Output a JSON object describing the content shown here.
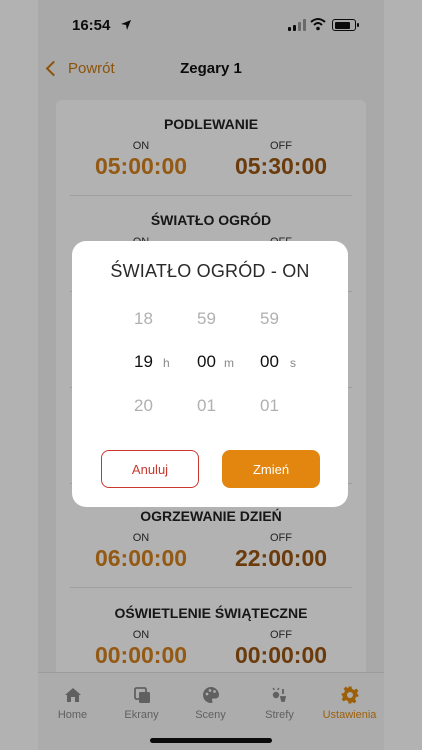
{
  "status_bar": {
    "time": "16:54"
  },
  "nav": {
    "back_label": "Powrót",
    "title": "Zegary 1"
  },
  "timers": [
    {
      "name": "PODLEWANIE",
      "on_label": "ON",
      "off_label": "OFF",
      "on": "05:00:00",
      "off": "05:30:00"
    },
    {
      "name": "ŚWIATŁO OGRÓD",
      "on_label": "ON",
      "off_label": "OFF",
      "on": "",
      "off": ""
    },
    {
      "name": "",
      "on_label": "",
      "off_label": "",
      "on": "",
      "off": ""
    },
    {
      "name": "",
      "on_label": "",
      "off_label": "",
      "on": "",
      "off": ""
    },
    {
      "name": "OGRZEWANIE DZIEŃ",
      "on_label": "ON",
      "off_label": "OFF",
      "on": "06:00:00",
      "off": "22:00:00"
    },
    {
      "name": "OŚWIETLENIE ŚWIĄTECZNE",
      "on_label": "ON",
      "off_label": "OFF",
      "on": "00:00:00",
      "off": "00:00:00"
    }
  ],
  "tabs": [
    {
      "label": "Home",
      "icon": "home-icon"
    },
    {
      "label": "Ekrany",
      "icon": "screens-icon"
    },
    {
      "label": "Sceny",
      "icon": "palette-icon"
    },
    {
      "label": "Strefy",
      "icon": "zones-icon"
    },
    {
      "label": "Ustawienia",
      "icon": "gear-icon",
      "active": true
    }
  ],
  "dialog": {
    "title": "ŚWIATŁO OGRÓD - ON",
    "hours": {
      "prev": "18",
      "current": "19",
      "next": "20",
      "unit": "h"
    },
    "minutes": {
      "prev": "59",
      "current": "00",
      "next": "01",
      "unit": "m"
    },
    "seconds": {
      "prev": "59",
      "current": "00",
      "next": "01",
      "unit": "s"
    },
    "cancel_label": "Anuluj",
    "confirm_label": "Zmień"
  },
  "colors": {
    "accent": "#e2860f",
    "on_value": "#d4801a",
    "off_value": "#9a5512",
    "cancel": "#c8382f"
  }
}
